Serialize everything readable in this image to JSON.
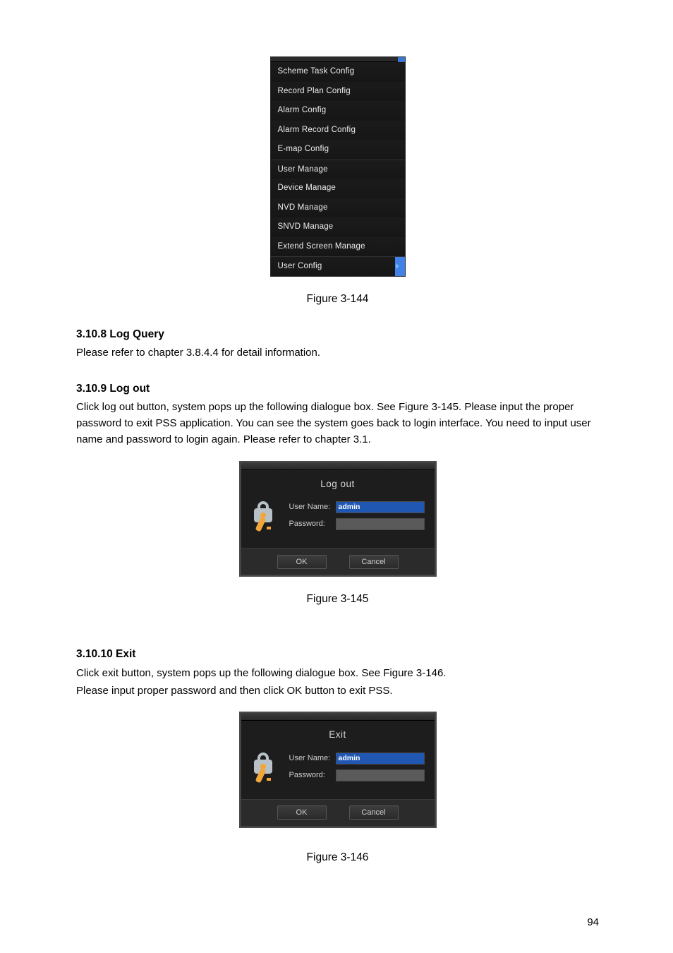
{
  "fig144_caption": "Figure 3-144",
  "menu": {
    "items": [
      {
        "label": "Scheme Task Config",
        "sep": false
      },
      {
        "label": "Record Plan Config",
        "sep": false
      },
      {
        "label": "Alarm Config",
        "sep": false
      },
      {
        "label": "Alarm Record Config",
        "sep": false
      },
      {
        "label": "E-map Config",
        "sep": false
      },
      {
        "label": "User Manage",
        "sep": true
      },
      {
        "label": "Device Manage",
        "sep": false
      },
      {
        "label": "NVD Manage",
        "sep": false
      },
      {
        "label": "SNVD Manage",
        "sep": false
      },
      {
        "label": "Extend Screen Manage",
        "sep": false
      },
      {
        "label": "User Config",
        "sep": true,
        "has_sub": true,
        "highlight": true
      }
    ]
  },
  "sec_logquery": {
    "heading": "3.10.8 Log Query",
    "body1": "Please refer to chapter 3.8.4.4 for detail information."
  },
  "sec_logout": {
    "heading": "3.10.9 Log out",
    "body1": "Click log out button, system pops up the following dialogue box. See Figure 3-145. Please input the proper password to exit PSS application. You can see the system goes back to login interface. You need to input user name and password to login again. Please refer to chapter 3.1.",
    "dialog": {
      "title": "Log out",
      "username_label": "User Name:",
      "username_value": "admin",
      "password_label": "Password:",
      "password_value": "",
      "ok_label": "OK",
      "cancel_label": "Cancel"
    },
    "fig_caption": "Figure 3-145"
  },
  "sec_exit": {
    "heading": "3.10.10   Exit",
    "body1": "Click exit button, system pops up the following dialogue box. See Figure 3-146.",
    "body2": "Please input proper password and then click OK button to exit PSS.",
    "dialog": {
      "title": "Exit",
      "username_label": "User Name:",
      "username_value": "admin",
      "password_label": "Password:",
      "password_value": "",
      "ok_label": "OK",
      "cancel_label": "Cancel"
    },
    "fig_caption": "Figure 3-146"
  },
  "page_number": "94"
}
